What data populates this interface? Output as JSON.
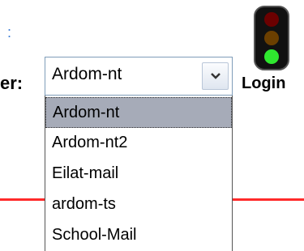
{
  "header": {
    "link_stub": ":",
    "server_label": "er:"
  },
  "server_select": {
    "selected": "Ardom-nt",
    "options": [
      "Ardom-nt",
      "Ardom-nt2",
      "Eilat-mail",
      "ardom-ts",
      "School-Mail"
    ]
  },
  "login": {
    "label": "Login",
    "icon": "traffic-light-icon"
  },
  "colors": {
    "highlight": "#a6abb8",
    "divider": "#ff2a2a",
    "light_red": "#6b0000",
    "light_amber": "#6b3f00",
    "light_green": "#2fe82f"
  }
}
